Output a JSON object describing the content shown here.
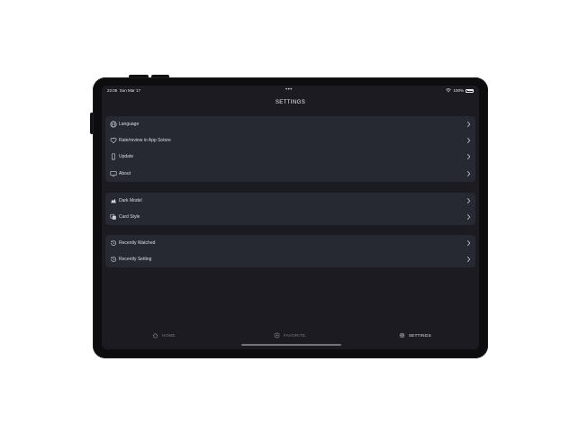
{
  "status_bar": {
    "time": "22:06",
    "date": "Sun Mar 17",
    "battery": "100%"
  },
  "header": {
    "title": "SETTINGS"
  },
  "groups": [
    {
      "items": [
        {
          "label": "Language",
          "icon": "globe-icon"
        },
        {
          "label": "Rate/review in App Sotore",
          "icon": "heart-icon"
        },
        {
          "label": "Update",
          "icon": "phone-icon"
        },
        {
          "label": "About",
          "icon": "monitor-icon"
        }
      ]
    },
    {
      "items": [
        {
          "label": "Dark Model",
          "icon": "theme-icon"
        },
        {
          "label": "Card Style",
          "icon": "cards-icon"
        }
      ]
    },
    {
      "items": [
        {
          "label": "Recently Watched",
          "icon": "history-icon"
        },
        {
          "label": "Recently Setting",
          "icon": "history-icon"
        }
      ]
    }
  ],
  "tabbar": {
    "home": "HOME",
    "favorite": "FAVORITE",
    "settings": "SETTINGS",
    "active": "settings"
  },
  "colors": {
    "background": "#1b1b21",
    "card": "#262832",
    "text": "#dedee4",
    "inactive_tab": "#7f808a"
  }
}
